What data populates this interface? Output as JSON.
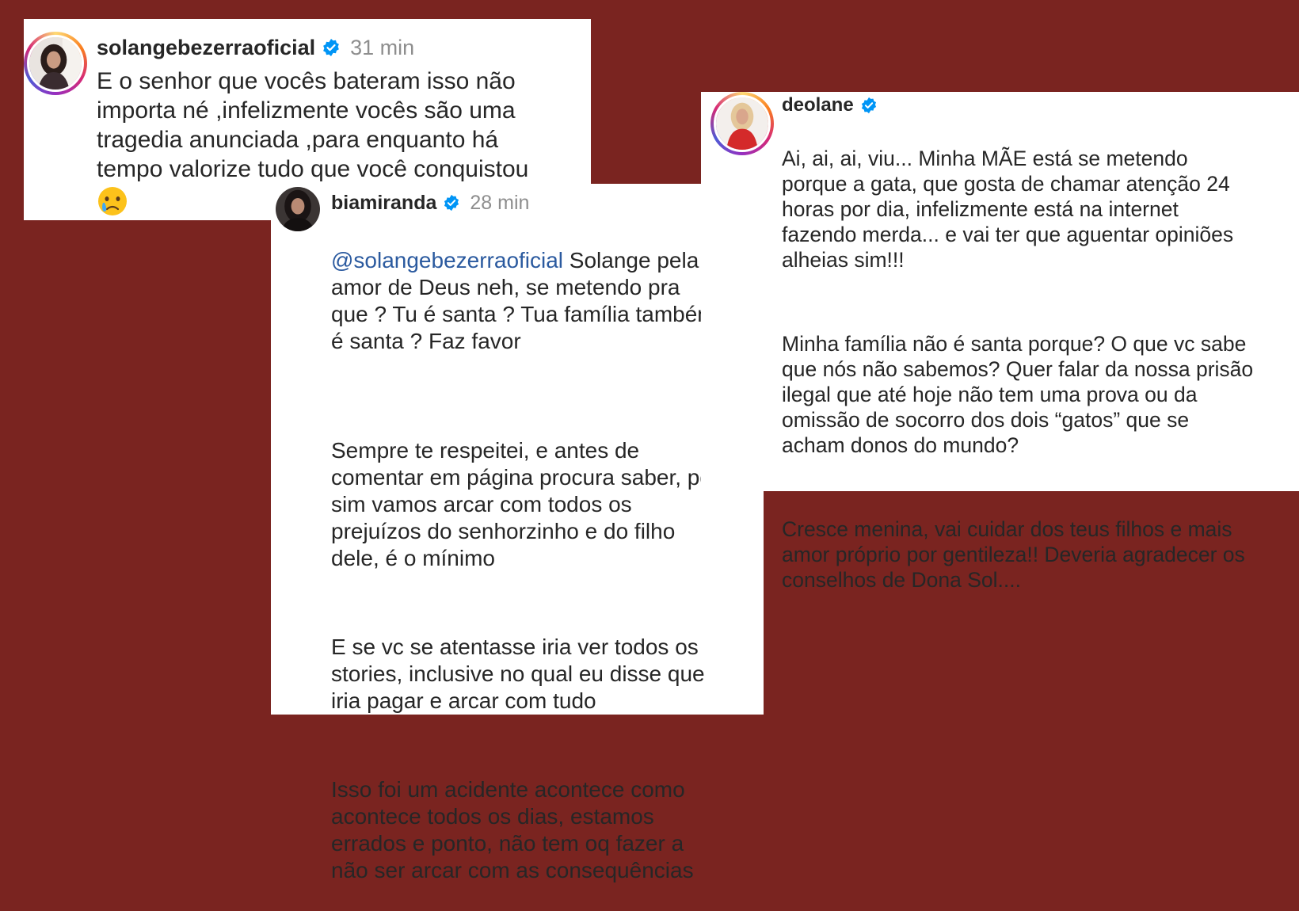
{
  "comments": [
    {
      "username": "solangebezerraoficial",
      "verified": true,
      "time": "31 min",
      "text": "E o senhor que vocês bateram isso não\nimporta né ,infelizmente vocês são uma\ntragedia anunciada ,para enquanto há\ntempo valorize tudo que você conquistou",
      "emoji": "crying-face"
    },
    {
      "username": "biamiranda",
      "verified": true,
      "time": "28 min",
      "mention": "@solangebezerraoficial",
      "paragraphs": [
        " Solange pela\namor de Deus neh, se metendo pra\nque ? Tu é santa ? Tua família também\né santa ? Faz favor",
        "Sempre te respeitei, e antes de\ncomentar em página procura saber, pq\nsim vamos arcar com todos os\nprejuízos do senhorzinho e do filho\ndele, é o mínimo",
        "E se vc se atentasse iria ver todos os\nstories, inclusive no qual eu disse que\niria pagar e arcar com tudo",
        "Isso foi um acidente acontece como\nacontece todos os dias, estamos\nerrados e ponto, não tem oq fazer a\nnão ser arcar com as consequências"
      ]
    },
    {
      "username": "deolane",
      "verified": true,
      "paragraphs": [
        "Ai, ai, ai, viu... Minha MÃE está se metendo\nporque a gata, que gosta de chamar atenção 24\nhoras por dia, infelizmente está na internet\nfazendo merda... e vai ter que aguentar opiniões\nalheias sim!!!",
        "Minha família não é santa porque? O que vc sabe\nque nós não sabemos? Quer falar da nossa prisão\nilegal que até hoje não tem uma prova ou da\nomissão de socorro dos dois “gatos” que se\nacham donos do mundo?",
        "Cresce menina, vai cuidar dos teus filhos e mais\namor próprio por gentileza!! Deveria agradecer os\nconselhos de Dona Sol...."
      ]
    }
  ],
  "colors": {
    "background": "#7a2420",
    "verified": "#0095f6",
    "mention": "#2b5a9f",
    "time": "#8e8e8e"
  }
}
